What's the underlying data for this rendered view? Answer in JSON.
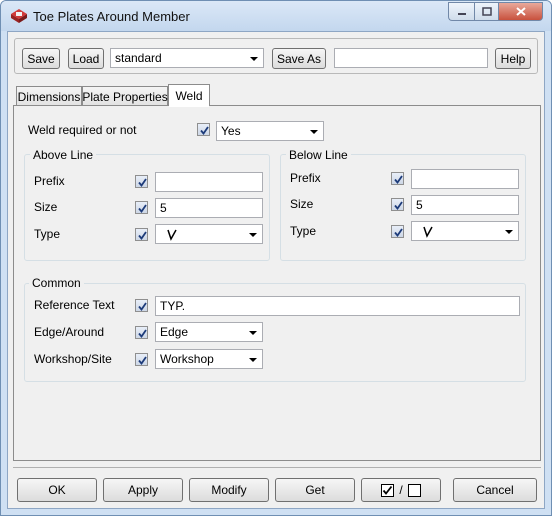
{
  "window": {
    "title": "Toe Plates Around Member"
  },
  "toolbar": {
    "save_label": "Save",
    "load_label": "Load",
    "preset_value": "standard",
    "save_as_label": "Save As",
    "save_as_value": "",
    "help_label": "Help"
  },
  "tabs": [
    {
      "label": "Dimensions"
    },
    {
      "label": "Plate Properties"
    },
    {
      "label": "Weld"
    }
  ],
  "weld": {
    "required_label": "Weld required or not",
    "required_value": "Yes",
    "above": {
      "title": "Above Line",
      "prefix_label": "Prefix",
      "prefix_value": "",
      "size_label": "Size",
      "size_value": "5",
      "type_label": "Type"
    },
    "below": {
      "title": "Below Line",
      "prefix_label": "Prefix",
      "prefix_value": "",
      "size_label": "Size",
      "size_value": "5",
      "type_label": "Type"
    },
    "common": {
      "title": "Common",
      "reference_label": "Reference Text",
      "reference_value": "TYP.",
      "edge_label": "Edge/Around",
      "edge_value": "Edge",
      "workshop_label": "Workshop/Site",
      "workshop_value": "Workshop"
    }
  },
  "footer": {
    "ok_label": "OK",
    "apply_label": "Apply",
    "modify_label": "Modify",
    "get_label": "Get",
    "toggle_slash": "/",
    "cancel_label": "Cancel"
  }
}
